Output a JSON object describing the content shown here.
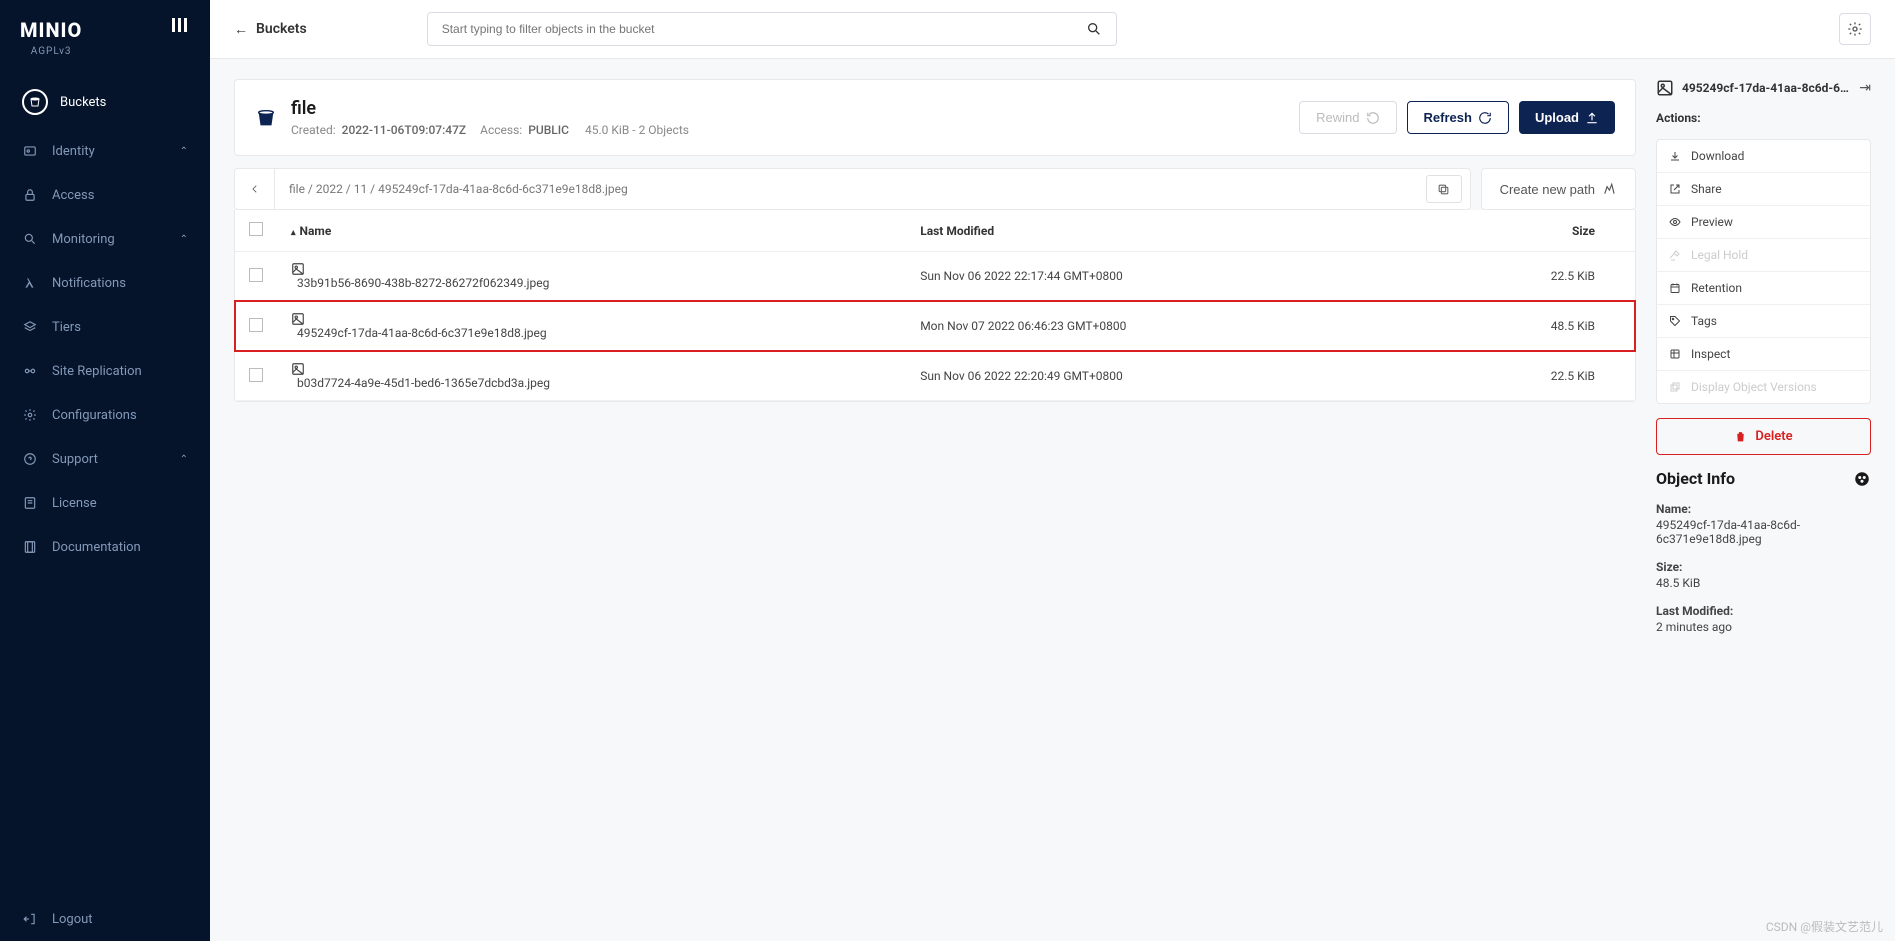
{
  "logo": {
    "text": "MINIO",
    "sub": "AGPLv3"
  },
  "sidebar": {
    "items": [
      {
        "label": "Buckets",
        "icon": "bucket",
        "active": true
      },
      {
        "label": "Identity",
        "icon": "identity",
        "expandable": true
      },
      {
        "label": "Access",
        "icon": "lock"
      },
      {
        "label": "Monitoring",
        "icon": "search",
        "expandable": true
      },
      {
        "label": "Notifications",
        "icon": "lambda"
      },
      {
        "label": "Tiers",
        "icon": "layers"
      },
      {
        "label": "Site Replication",
        "icon": "replication"
      },
      {
        "label": "Configurations",
        "icon": "gear"
      },
      {
        "label": "Support",
        "icon": "support",
        "expandable": true
      },
      {
        "label": "License",
        "icon": "license"
      },
      {
        "label": "Documentation",
        "icon": "doc"
      }
    ],
    "logout": "Logout"
  },
  "topbar": {
    "back_label": "Buckets",
    "search_placeholder": "Start typing to filter objects in the bucket"
  },
  "bucket": {
    "name": "file",
    "created_label": "Created:",
    "created_value": "2022-11-06T09:07:47Z",
    "access_label": "Access:",
    "access_value": "PUBLIC",
    "stats": "45.0 KiB - 2 Objects",
    "rewind": "Rewind",
    "refresh": "Refresh",
    "upload": "Upload"
  },
  "breadcrumb": {
    "path": "file  /  2022  /  11  /  495249cf-17da-41aa-8c6d-6c371e9e18d8.jpeg",
    "new_path": "Create new path"
  },
  "table": {
    "cols": {
      "name": "Name",
      "modified": "Last Modified",
      "size": "Size"
    },
    "rows": [
      {
        "name": "33b91b56-8690-438b-8272-86272f062349.jpeg",
        "modified": "Sun Nov 06 2022 22:17:44 GMT+0800",
        "size": "22.5 KiB",
        "highlight": false
      },
      {
        "name": "495249cf-17da-41aa-8c6d-6c371e9e18d8.jpeg",
        "modified": "Mon Nov 07 2022 06:46:23 GMT+0800",
        "size": "48.5 KiB",
        "highlight": true
      },
      {
        "name": "b03d7724-4a9e-45d1-bed6-1365e7dcbd3a.jpeg",
        "modified": "Sun Nov 06 2022 22:20:49 GMT+0800",
        "size": "22.5 KiB",
        "highlight": false
      }
    ]
  },
  "panel": {
    "title": "495249cf-17da-41aa-8c6d-6c3...",
    "actions_label": "Actions:",
    "actions": [
      {
        "label": "Download",
        "icon": "download",
        "enabled": true
      },
      {
        "label": "Share",
        "icon": "share",
        "enabled": true
      },
      {
        "label": "Preview",
        "icon": "eye",
        "enabled": true
      },
      {
        "label": "Legal Hold",
        "icon": "gavel",
        "enabled": false
      },
      {
        "label": "Retention",
        "icon": "calendar",
        "enabled": true
      },
      {
        "label": "Tags",
        "icon": "tag",
        "enabled": true
      },
      {
        "label": "Inspect",
        "icon": "inspect",
        "enabled": true
      },
      {
        "label": "Display Object Versions",
        "icon": "versions",
        "enabled": false
      }
    ],
    "delete": "Delete",
    "info_title": "Object Info",
    "info": {
      "name_k": "Name:",
      "name_v": "495249cf-17da-41aa-8c6d-6c371e9e18d8.jpeg",
      "size_k": "Size:",
      "size_v": "48.5 KiB",
      "mod_k": "Last Modified:",
      "mod_v": "2 minutes ago"
    }
  },
  "watermark": "CSDN @假装文艺范儿"
}
